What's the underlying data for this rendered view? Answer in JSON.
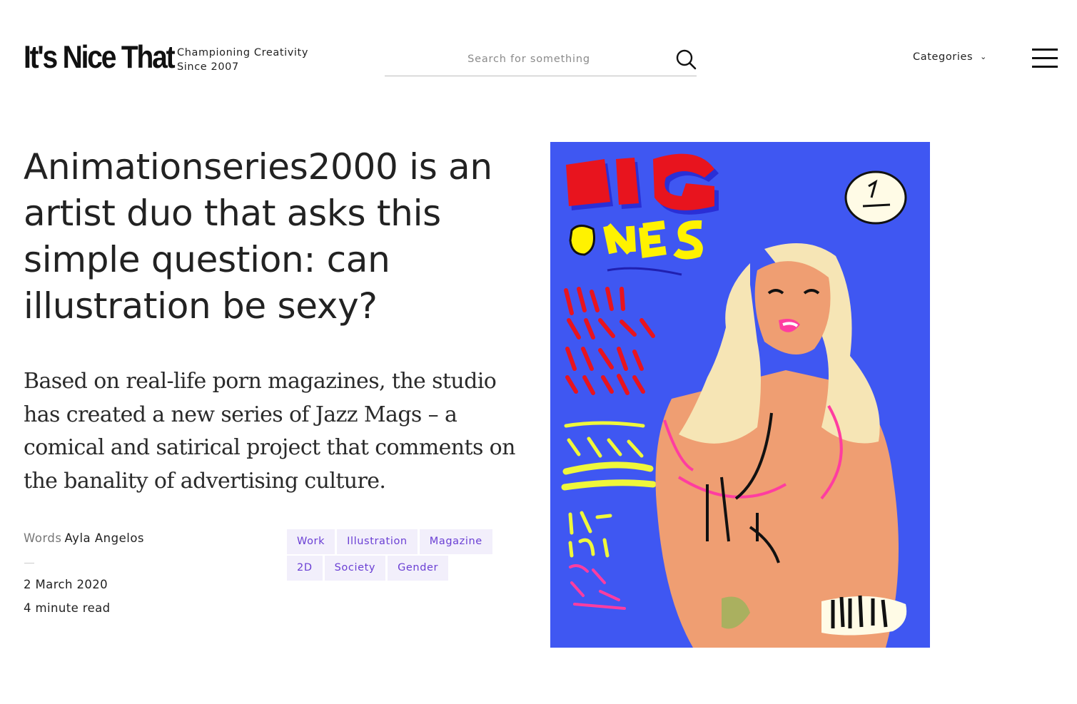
{
  "header": {
    "logo": "It's Nice That",
    "tagline_line1": "Championing Creativity",
    "tagline_line2": "Since 2007",
    "search_placeholder": "Search for something",
    "categories_label": "Categories"
  },
  "article": {
    "headline": "Animationseries2000 is an artist duo that asks this simple question: can illustration be sexy?",
    "standfirst": "Based on real-life porn magazines, the studio has created a new series of Jazz Mags – a comical and satirical project that comments on the banality of advertising culture.",
    "byline_label": "Words",
    "author": "Ayla Angelos",
    "date": "2 March 2020",
    "read_time": "4 minute read",
    "tags": [
      [
        "Work",
        "Illustration",
        "Magazine"
      ],
      [
        "2D",
        "Society",
        "Gender"
      ]
    ]
  },
  "colors": {
    "tag_bg": "#f2effb",
    "tag_text": "#6a3fd4",
    "cover_bg": "#3f57f2"
  },
  "icons": [
    "search-icon",
    "chevron-down-icon",
    "menu-icon"
  ]
}
